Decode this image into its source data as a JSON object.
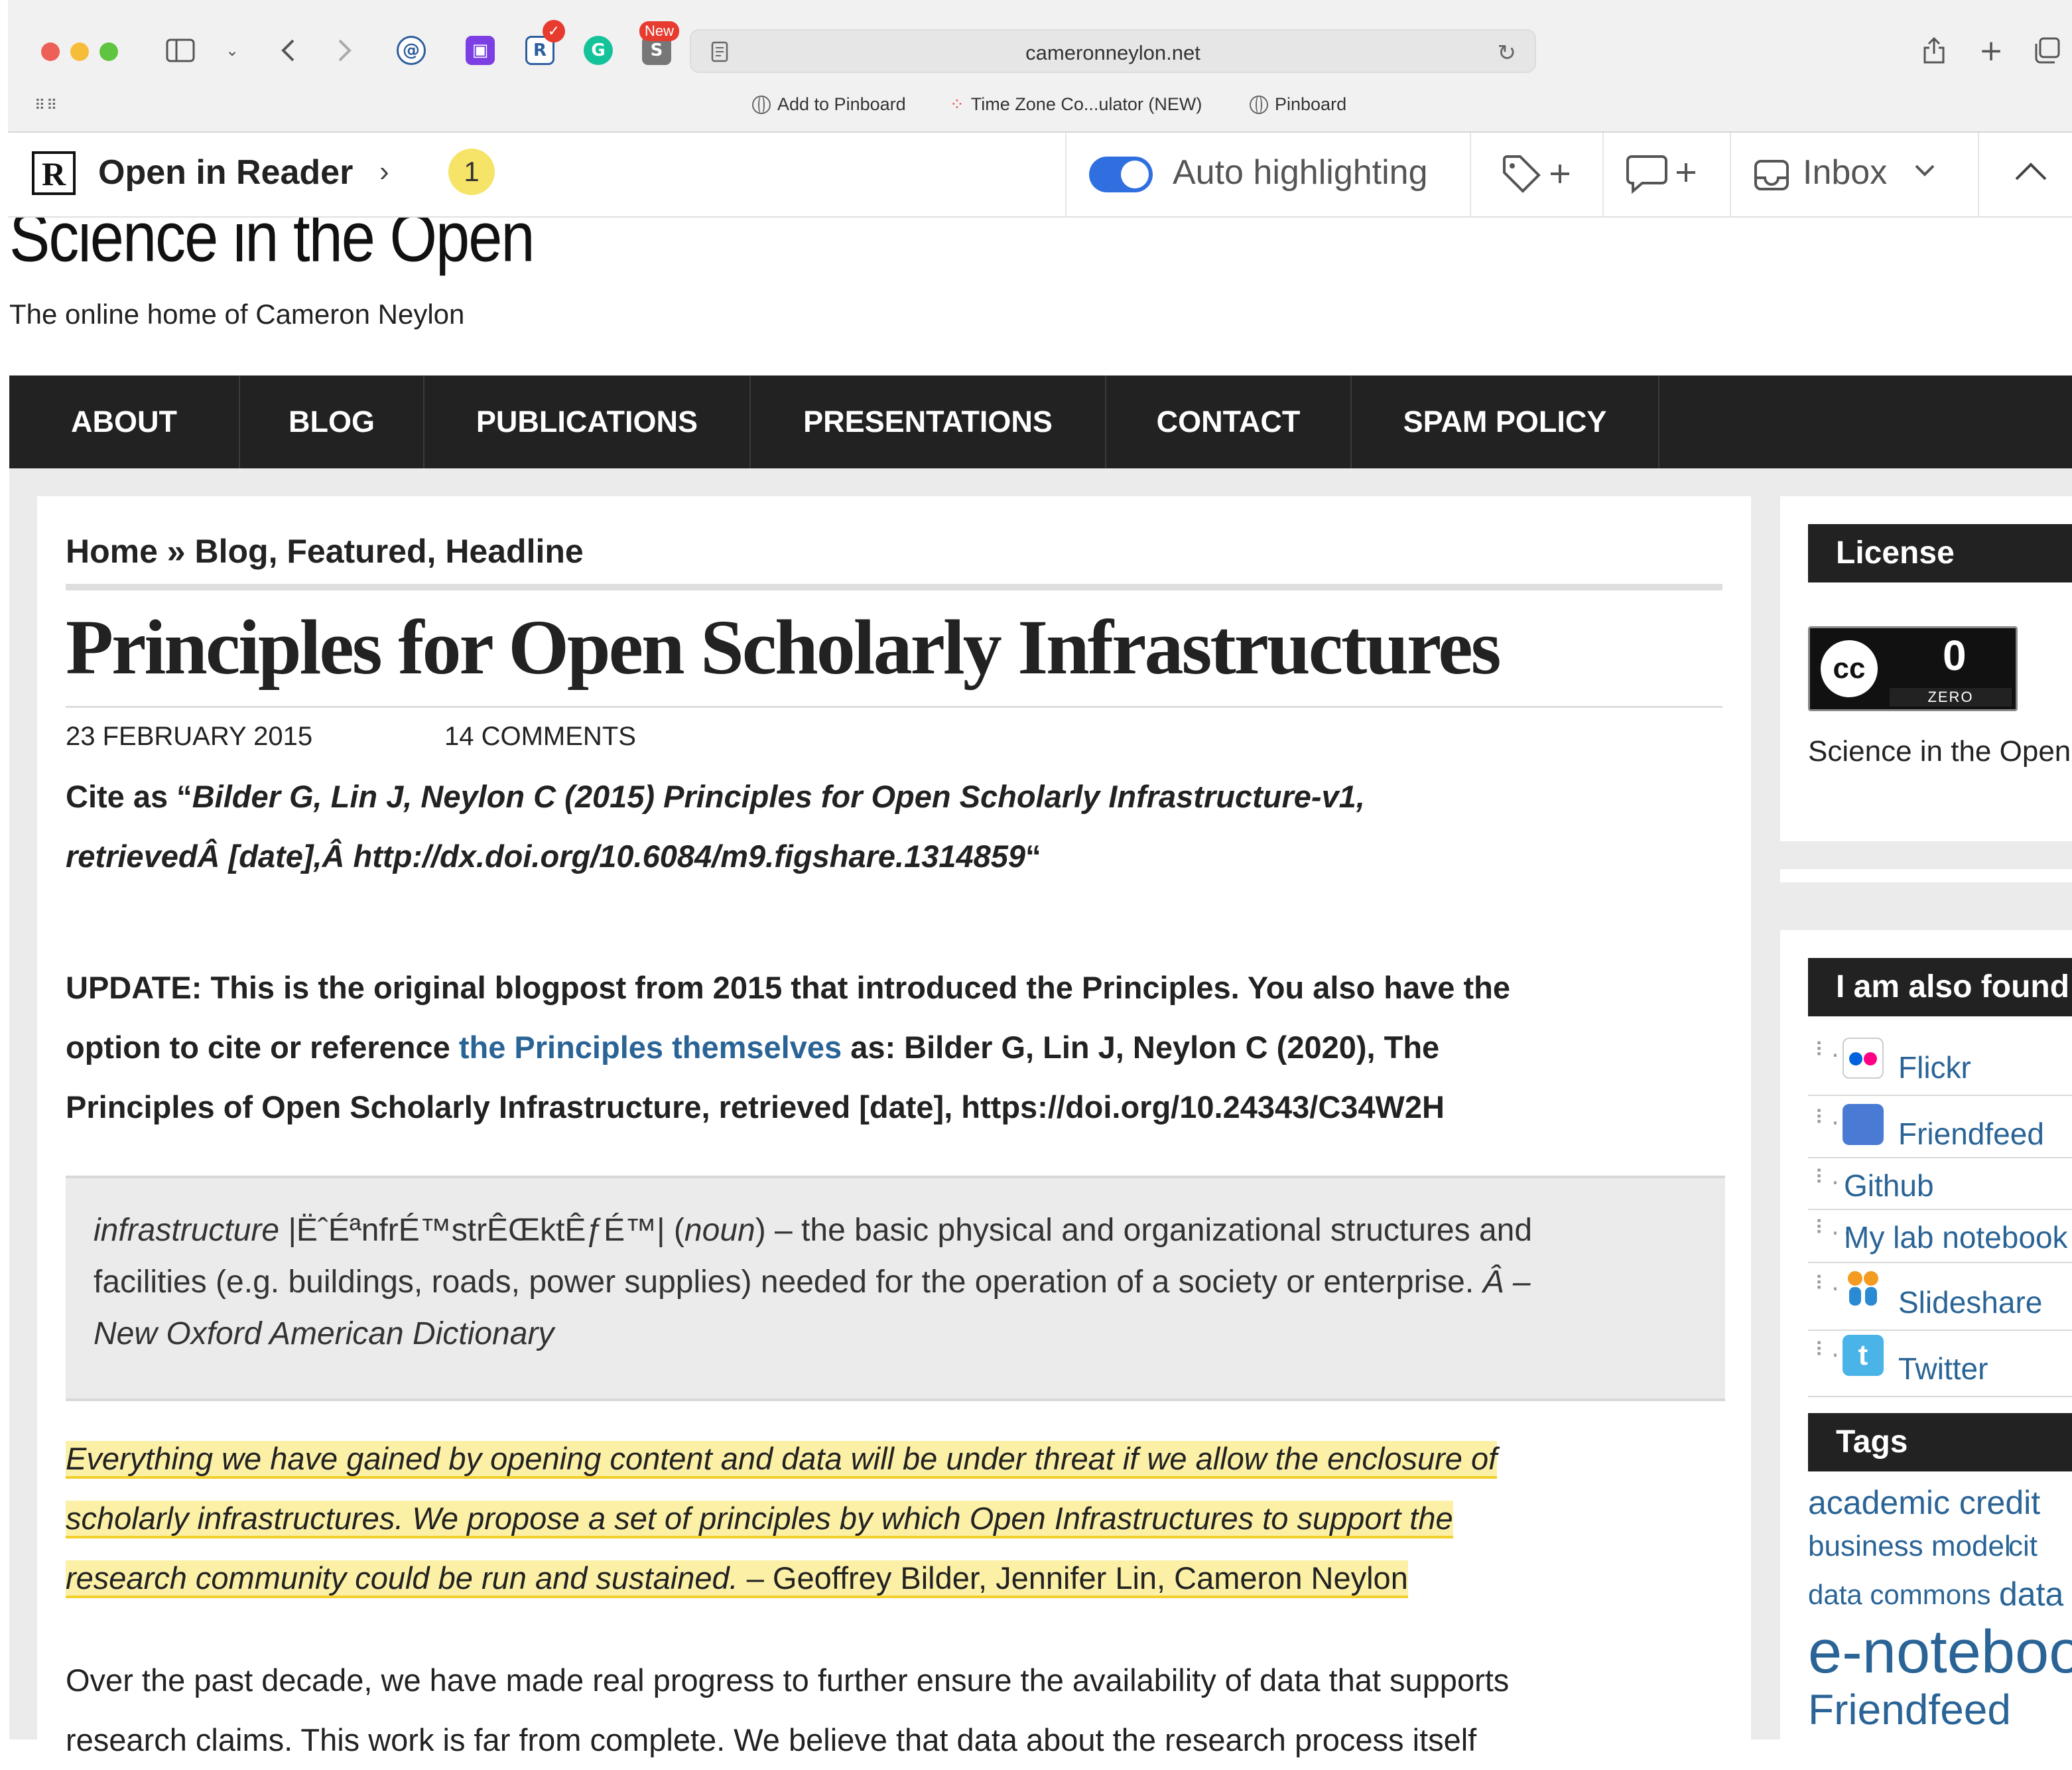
{
  "browser": {
    "url": "cameronneylon.net",
    "new_badge": "New",
    "bookmarks": [
      "Add to Pinboard",
      "Time Zone Co...ulator (NEW)",
      "Pinboard"
    ]
  },
  "reader": {
    "open_label": "Open in Reader",
    "badge_count": "1",
    "auto_highlighting": "Auto highlighting",
    "inbox": "Inbox"
  },
  "site": {
    "title": "Science in the Open",
    "tagline": "The online home of Cameron Neylon"
  },
  "nav": [
    "ABOUT",
    "BLOG",
    "PUBLICATIONS",
    "PRESENTATIONS",
    "CONTACT",
    "SPAM POLICY"
  ],
  "post": {
    "breadcrumb": "Home » Blog, Featured, Headline",
    "title": "Principles for Open Scholarly Infrastructures",
    "date": "23 FEBRUARY 2015",
    "comments": "14 COMMENTS",
    "cite_prefix": "Cite as “",
    "cite_italic_1": "Bilder G, Lin J, Neylon C (2015) Principles for Open Scholarly Infrastructure-v1,",
    "cite_italic_2": "retrievedÂ [date],Â http://dx.doi.org/10.6084/m9.figshare.1314859",
    "cite_suffix": "“",
    "update_1": "UPDATE: This is the original blogpost from 2015 that introduced the Principles. You also have the",
    "update_2a": "option to cite or reference ",
    "update_link": "the Principles themselves",
    "update_2b": " as: Bilder G, Lin J, Neylon C (2020), The",
    "update_3": "Principles of Open Scholarly Infrastructure, retrieved [date], https://doi.org/10.24343/C34W2H",
    "quote_term": "infrastructure",
    "quote_pron": " |ËˆÉªnfrÉ™strÊŒktÊƒÉ™| (",
    "quote_pos": "noun",
    "quote_def_1": ") – the basic physical and organizational structures and",
    "quote_def_2": "facilities (e.g. buildings, roads, power supplies) needed for the operation of a society or enterprise. ",
    "quote_src_a": "Â –",
    "quote_src_b": "New Oxford American Dictionary",
    "highlight_1": "Everything we have gained by opening content and data will be under threat if we allow the enclosure of",
    "highlight_2": "scholarly infrastructures. We propose a set of principles by which Open Infrastructures to support the",
    "highlight_3_italic": "research community could be run and sustained.",
    "highlight_3_authors": " – Geoffrey Bilder, Jennifer Lin, Cameron Neylon",
    "body_1": "Over the past decade, we have made real progress to further ensure the availability of data that supports",
    "body_2": "research claims. This work is far from complete. We believe that data about the research process itself"
  },
  "sidebar": {
    "license_title": "License",
    "cc_label": "ZERO",
    "cc_mark": "0",
    "license_text": "Science in the Open",
    "found_title": "I am also found",
    "found_links": [
      "Flickr",
      "Friendfeed",
      "Github",
      "My lab notebook",
      "Slideshare",
      "Twitter"
    ],
    "tags_title": "Tags",
    "tags": [
      "academic credit",
      "business model",
      "cit",
      "data commons",
      "data",
      "e-notebook",
      "Friendfeed"
    ]
  }
}
